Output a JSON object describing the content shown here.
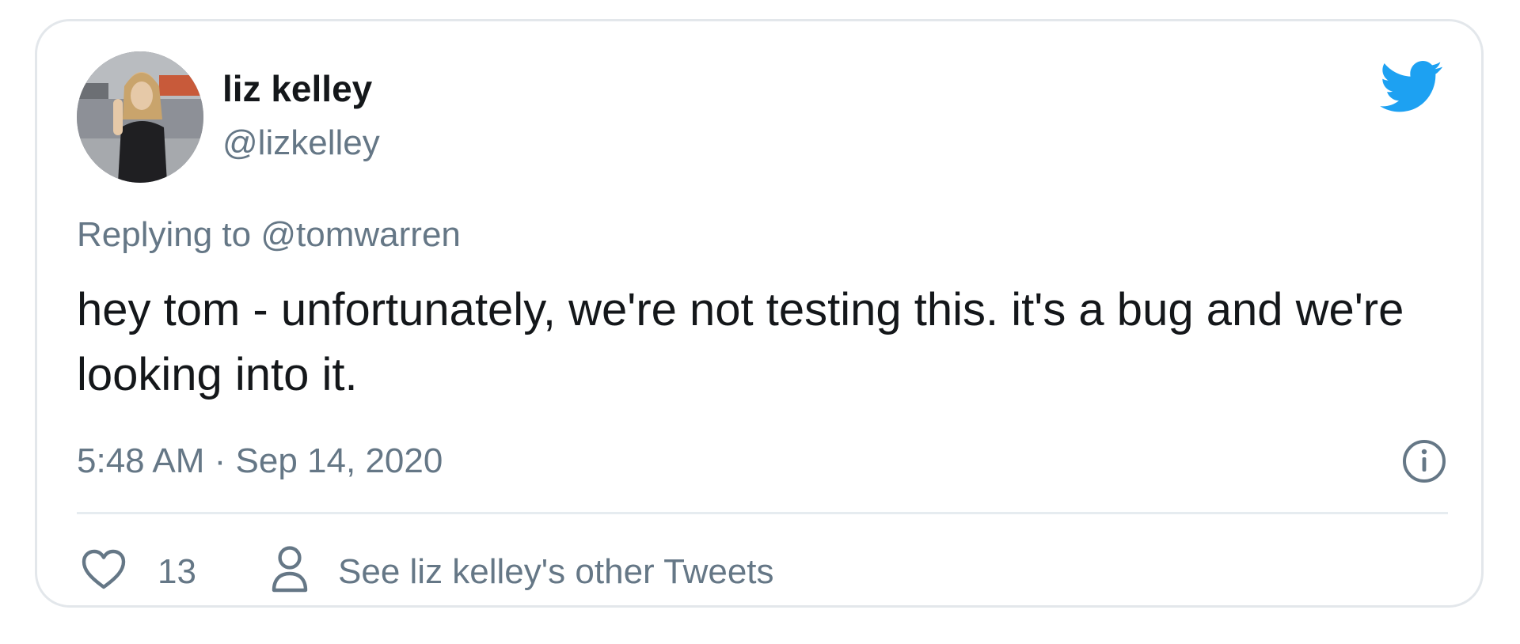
{
  "colors": {
    "accent": "#1da1f2",
    "text_primary": "#14171a",
    "text_secondary": "#657786",
    "border": "#e3e7eb"
  },
  "author": {
    "display_name": "liz kelley",
    "handle": "@lizkelley",
    "avatar_icon": "profile-photo"
  },
  "reply": {
    "prefix": "Replying to",
    "to_handle": "@tomwarren"
  },
  "tweet": {
    "text": "hey tom - unfortunately, we're not testing this. it's a bug and we're looking into it.",
    "timestamp": "5:48 AM · Sep 14, 2020"
  },
  "actions": {
    "like_icon": "heart-icon",
    "like_count": "13",
    "profile_icon": "person-icon",
    "other_tweets_label": "See liz kelley's other Tweets",
    "info_icon": "info-icon",
    "brand_icon": "twitter-bird-icon"
  }
}
